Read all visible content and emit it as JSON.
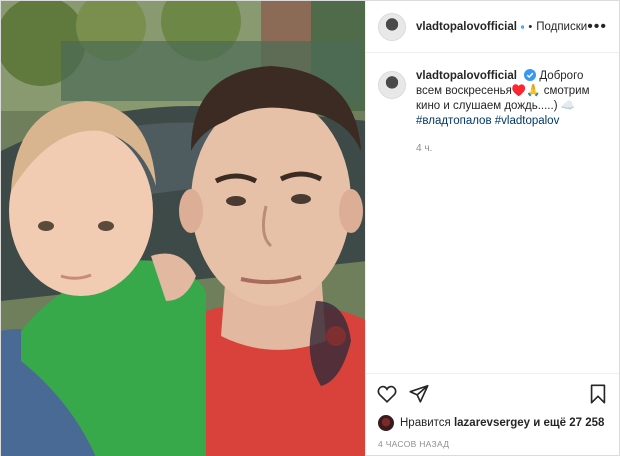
{
  "post": {
    "username": "vladtopalovofficial",
    "follow_label": "Подписки",
    "caption_text": "Доброго всем воскресенья♥️🙏 смотрим кино и слушаем дождь.....) ☁️",
    "hashtags": "#владтопалов #vladtopalov",
    "time_short": "4 ч.",
    "likes_prefix": "Нравится",
    "likes_user": "lazarevsergey",
    "likes_suffix": "и ещё 27 258",
    "time_long": "4 ЧАСОВ НАЗАД"
  },
  "icons": {
    "verified": "verified-badge-icon",
    "more": "more-options-icon",
    "like": "heart-icon",
    "share": "share-icon",
    "save": "bookmark-icon"
  },
  "colors": {
    "link": "#00376b",
    "verified": "#3897f0",
    "muted": "#8e8e8e",
    "border": "#dbdbdb"
  }
}
